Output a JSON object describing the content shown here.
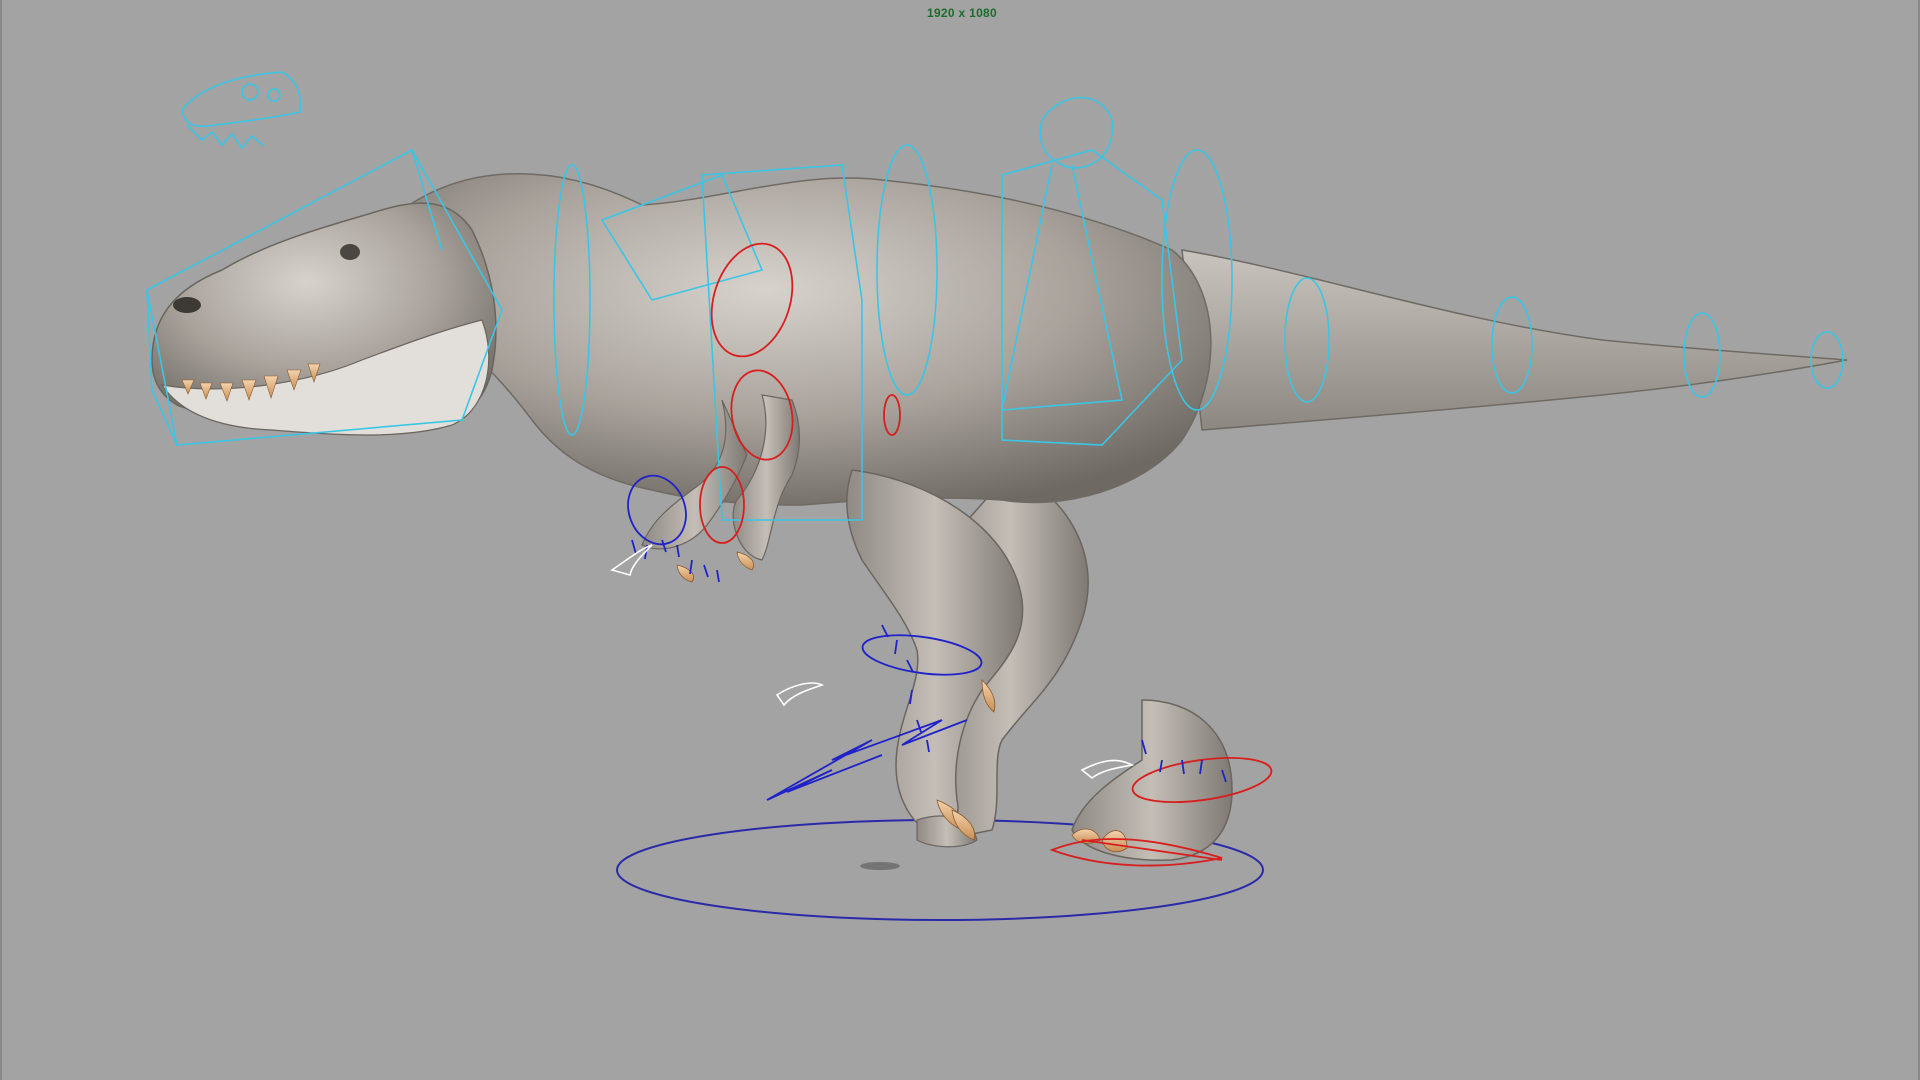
{
  "viewport": {
    "resolution_label": "1920 x 1080",
    "background_color": "#a3a3a3"
  },
  "rig": {
    "model": "tyrannosaurus",
    "control_colors": {
      "center": "#39c6e6",
      "left": "#d81e1e",
      "right": "#1f22c8",
      "fk_fingers": "#ffffff"
    },
    "icons": [
      "skull-icon"
    ]
  }
}
